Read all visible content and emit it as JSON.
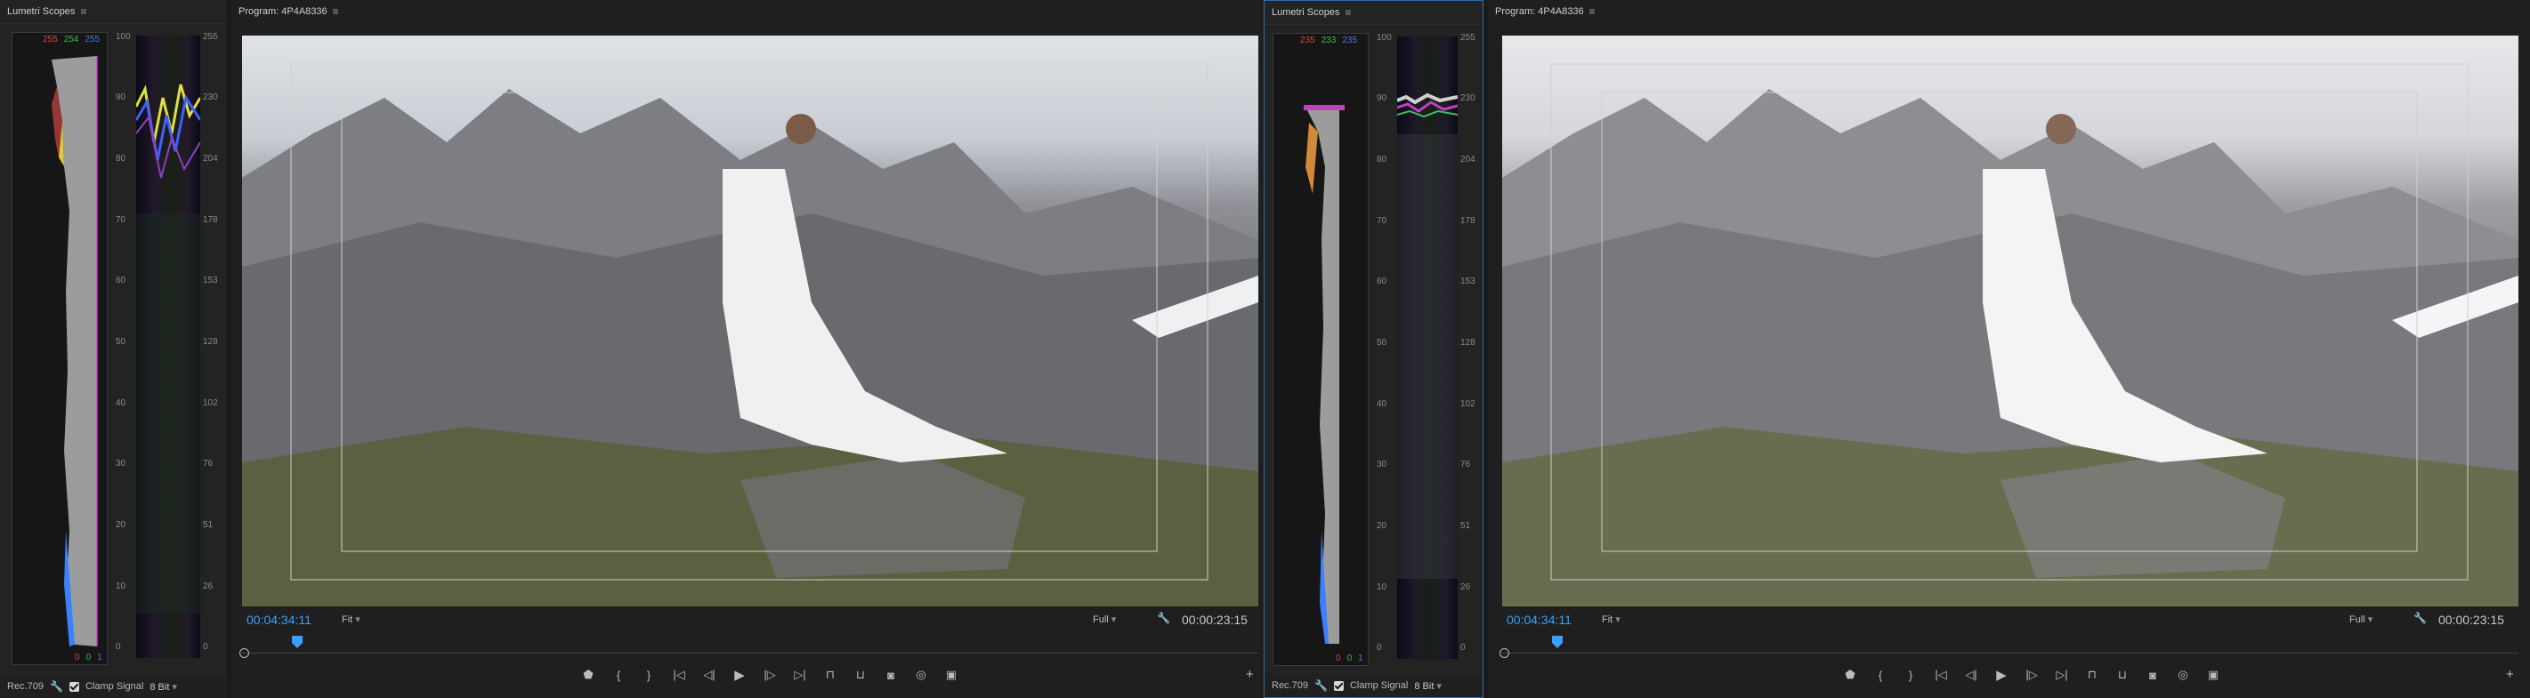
{
  "scopes": [
    {
      "title": "Lumetri Scopes",
      "rgb": {
        "r": "255",
        "g": "254",
        "b": "255"
      },
      "bottom_rgb": {
        "r": "0",
        "g": "0",
        "b": "1"
      },
      "scale_percent": [
        "100",
        "90",
        "80",
        "70",
        "60",
        "50",
        "40",
        "30",
        "20",
        "10",
        "0"
      ],
      "scale_8bit": [
        "255",
        "230",
        "204",
        "178",
        "153",
        "128",
        "102",
        "76",
        "51",
        "26",
        "0"
      ],
      "footer": {
        "colorspace": "Rec.709",
        "clamp_label": "Clamp Signal",
        "bitdepth": "8 Bit"
      }
    },
    {
      "title": "Lumetri Scopes",
      "rgb": {
        "r": "235",
        "g": "233",
        "b": "235"
      },
      "bottom_rgb": {
        "r": "0",
        "g": "0",
        "b": "1"
      },
      "scale_percent": [
        "100",
        "90",
        "80",
        "70",
        "60",
        "50",
        "40",
        "30",
        "20",
        "10",
        "0"
      ],
      "scale_8bit": [
        "255",
        "230",
        "204",
        "178",
        "153",
        "128",
        "102",
        "76",
        "51",
        "26",
        "0"
      ],
      "footer": {
        "colorspace": "Rec.709",
        "clamp_label": "Clamp Signal",
        "bitdepth": "8 Bit"
      }
    }
  ],
  "programs": [
    {
      "title": "Program: 4P4A8336",
      "timecode": "00:04:34:11",
      "zoom": "Fit",
      "resolution": "Full",
      "duration": "00:00:23:15"
    },
    {
      "title": "Program: 4P4A8336",
      "timecode": "00:04:34:11",
      "zoom": "Fit",
      "resolution": "Full",
      "duration": "00:00:23:15"
    }
  ],
  "colors": {
    "accent": "#3aa0ff",
    "panel_bg": "#232323",
    "frame_bg": "#1a1a1a"
  },
  "icons": [
    "menu-icon",
    "wrench-icon",
    "add-marker-icon",
    "mark-in-icon",
    "mark-out-icon",
    "go-to-in-icon",
    "step-back-icon",
    "play-icon",
    "step-forward-icon",
    "go-to-out-icon",
    "lift-icon",
    "extract-icon",
    "export-frame-icon",
    "comparison-view-icon",
    "button-editor-icon",
    "plus-icon"
  ]
}
